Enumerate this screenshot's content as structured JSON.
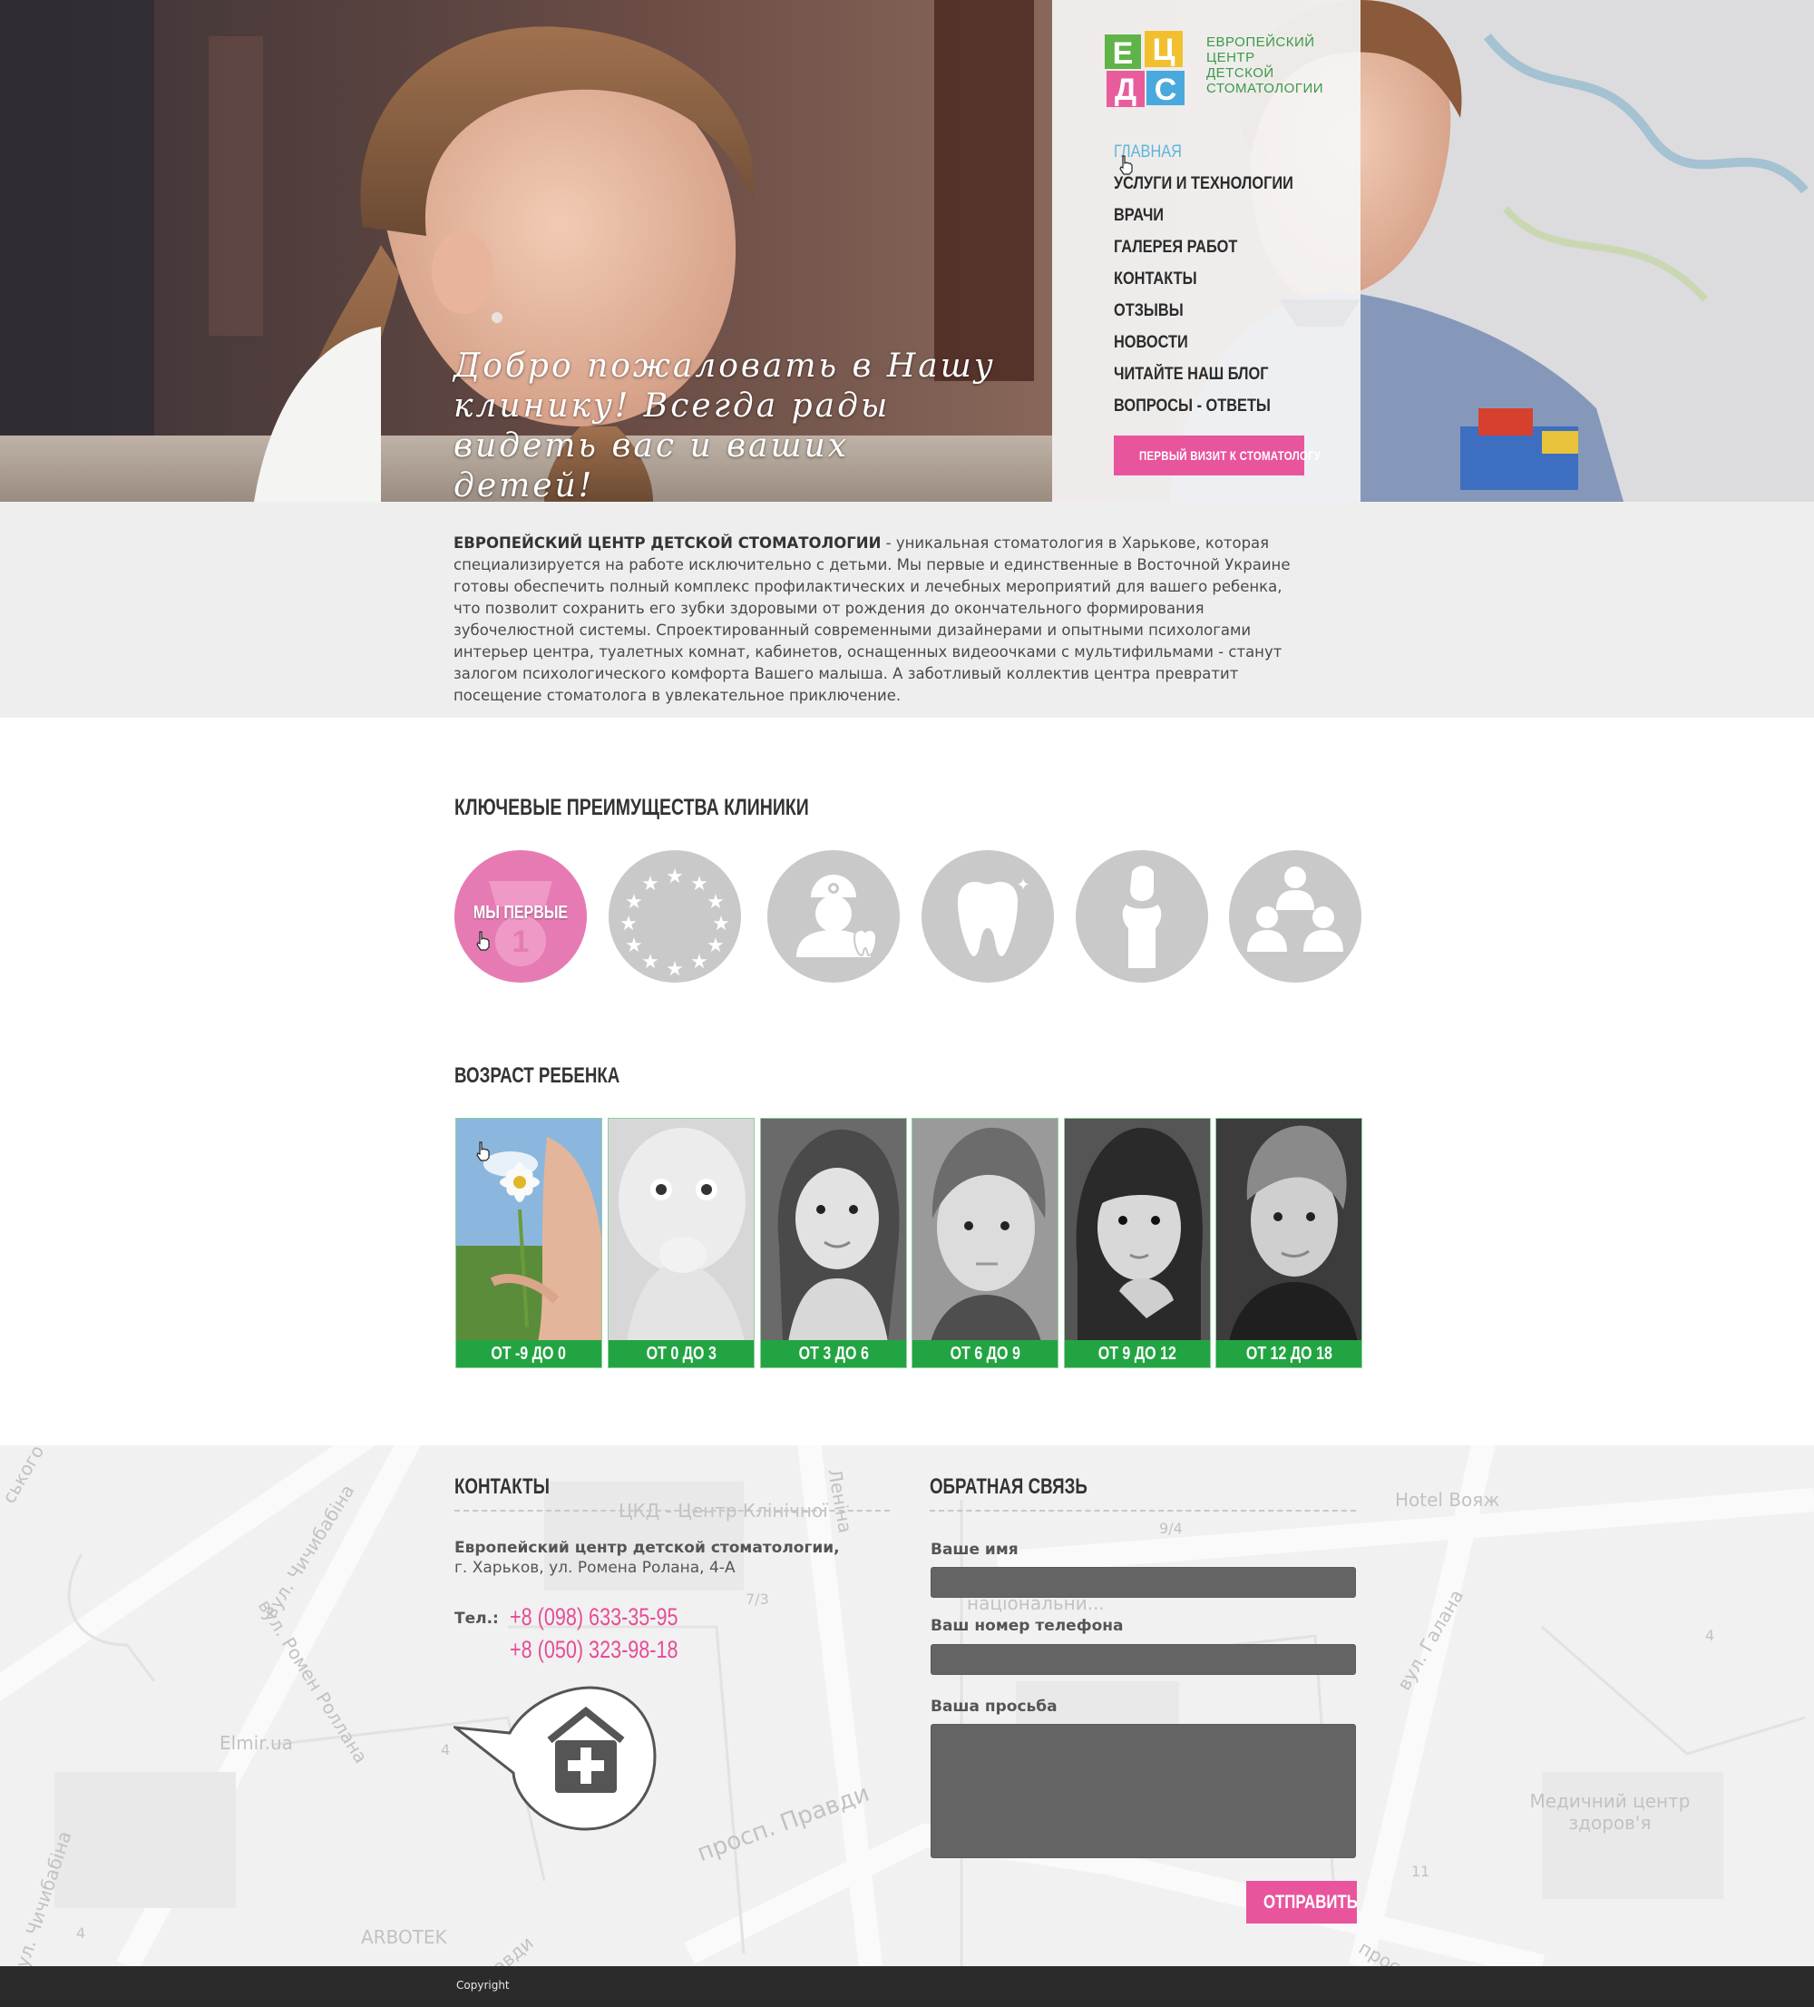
{
  "hero": {
    "welcome_text": "Добро пожаловать в Нашу клинику! Всегда рады видеть вас и ваших детей!",
    "logo_text": [
      "ЕВРОПЕЙСКИЙ",
      "ЦЕНТР",
      "ДЕТСКОЙ",
      "СТОМАТОЛОГИИ"
    ],
    "logo_letters": [
      "Е",
      "Ц",
      "Д",
      "С"
    ],
    "nav": [
      {
        "label": "ГЛАВНАЯ",
        "active": true
      },
      {
        "label": "УСЛУГИ И ТЕХНОЛОГИИ"
      },
      {
        "label": "ВРАЧИ"
      },
      {
        "label": "ГАЛЕРЕЯ РАБОТ"
      },
      {
        "label": "КОНТАКТЫ"
      },
      {
        "label": "ОТЗЫВЫ"
      },
      {
        "label": "НОВОСТИ"
      },
      {
        "label": "ЧИТАЙТЕ НАШ БЛОГ"
      },
      {
        "label": "ВОПРОСЫ - ОТВЕТЫ"
      }
    ],
    "cta_label": "ПЕРВЫЙ ВИЗИТ К СТОМАТОЛОГУ"
  },
  "about": {
    "title": "ЕВРОПЕЙСКИЙ ЦЕНТР ДЕТСКОЙ СТОМАТОЛОГИИ",
    "text": " - уникальная стоматология в Харькове, которая специализируется на работе исключительно с детьми. Мы первые и единственные в Восточной Украине готовы обеспечить полный комплекс профилактических и лечебных мероприятий для вашего ребенка, что позволит сохранить его зубки здоровыми от рождения до окончательного формирования зубочелюстной системы. Спроектированный современными дизайнерами и опытными психологами интерьер центра, туалетных комнат, кабинетов, оснащенных видеоочками с мультифильмами - станут залогом психологического комфорта Вашего малыша. А заботливый коллектив центра превратит посещение стоматолога в увлекательное приключение."
  },
  "advantages": {
    "title": "КЛЮЧЕВЫЕ ПРЕИМУЩЕСТВА КЛИНИКИ",
    "items": [
      {
        "icon": "medal-icon",
        "label": "МЫ ПЕРВЫЕ",
        "active": true
      },
      {
        "icon": "eu-stars-icon"
      },
      {
        "icon": "dentist-icon"
      },
      {
        "icon": "tooth-icon"
      },
      {
        "icon": "nurse-icon"
      },
      {
        "icon": "team-icon"
      }
    ]
  },
  "ages": {
    "title": "ВОЗРАСТ РЕБЕНКА",
    "items": [
      {
        "label": "ОТ -9 ДО 0"
      },
      {
        "label": "ОТ 0 ДО 3"
      },
      {
        "label": "ОТ 3 ДО 6"
      },
      {
        "label": "ОТ 6 ДО 9"
      },
      {
        "label": "ОТ 9 ДО 12"
      },
      {
        "label": "ОТ 12 ДО 18"
      }
    ]
  },
  "contacts": {
    "title": "КОНТАКТЫ",
    "name": "Европейский центр детской стоматологии,",
    "address": "г. Харьков, ул. Ромена Ролана, 4-А",
    "tel_label": "Тел.:",
    "phones": [
      "+8 (098) 633-35-95",
      "+8 (050) 323-98-18"
    ]
  },
  "feedback": {
    "title": "ОБРАТНАЯ СВЯЗЬ",
    "name_label": "Ваше имя",
    "phone_label": "Ваш номер телефона",
    "request_label": "Ваша просьба",
    "name_value": "",
    "phone_value": "",
    "request_value": "",
    "submit_label": "ОТПРАВИТЬ"
  },
  "map_labels": {
    "ckd": "ЦКД - Центр Клінічної",
    "chichibabina": "вул. Чичибабіна",
    "romen_rollan": "вул. Ромен Роллана",
    "elmir": "Elmir.ua",
    "pravdy": "просп. Правди",
    "lenina": "Леніна",
    "hotel": "Hotel Вояж",
    "galana": "вул. Галана",
    "medical": "Медичний центр здоров'я",
    "arbotek": "ARBOTEK",
    "natsional": "національни...",
    "chichibabina2": "вул. Чичибабіна",
    "pravdy2": "авди",
    "pros": "просп",
    "n94": "9/4",
    "n73": "7/3",
    "n4": "4",
    "n11": "11",
    "n4b": "4",
    "n4c": "4",
    "skogo": "ського"
  },
  "footer": {
    "copyright": "Copyright"
  },
  "colors": {
    "accent_pink": "#e8559d",
    "nav_active": "#5fb4dd",
    "age_green": "#23a443",
    "logo_green": "#3a9a48"
  }
}
